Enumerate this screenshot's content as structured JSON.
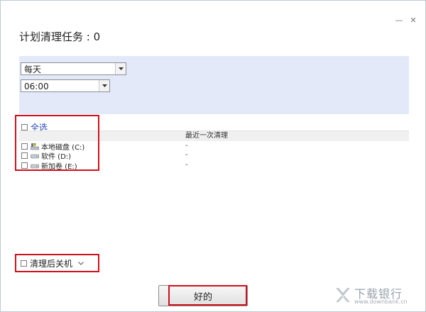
{
  "window": {
    "minimize_glyph": "—",
    "close_glyph": "✕"
  },
  "header": {
    "title": "计划清理任务 : 0"
  },
  "schedule": {
    "frequency_value": "每天",
    "time_value": "06:00"
  },
  "drives": {
    "select_all_label": "全选",
    "column_last_cleaned": "最近一次清理",
    "rows": [
      {
        "name": "本地磁盘 (C:)",
        "last_cleaned": "-",
        "icon": "system-drive-icon"
      },
      {
        "name": "软件 (D:)",
        "last_cleaned": "-",
        "icon": "drive-icon"
      },
      {
        "name": "新加卷 (E:)",
        "last_cleaned": "-",
        "icon": "drive-icon"
      }
    ]
  },
  "footer": {
    "shutdown_label": "清理后关机",
    "ok_label": "好的"
  },
  "watermark": {
    "text": "下载银行",
    "url": "www.downbank.cn"
  },
  "colors": {
    "panel_bg": "#e3e9f9",
    "highlight_red": "#d0101b",
    "link_blue": "#2646b7"
  }
}
